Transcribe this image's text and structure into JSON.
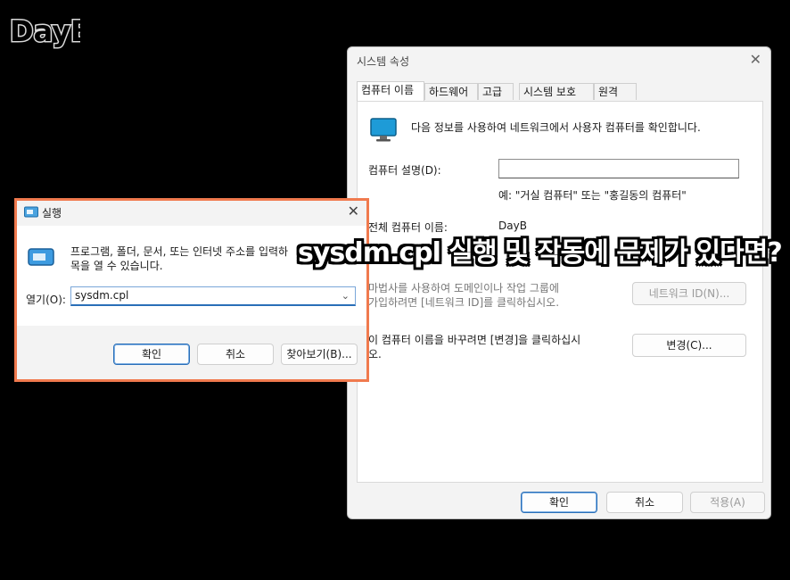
{
  "logo": {
    "text": "DayB"
  },
  "system_properties": {
    "title": "시스템 속성",
    "tabs": [
      {
        "label": "컴퓨터 이름",
        "active": true
      },
      {
        "label": "하드웨어"
      },
      {
        "label": "고급"
      },
      {
        "label": "시스템 보호"
      },
      {
        "label": "원격"
      }
    ],
    "info_text": "다음 정보를 사용하여 네트워크에서 사용자 컴퓨터를 확인합니다.",
    "description_label": "컴퓨터 설명(D):",
    "description_value": "",
    "description_hint": "예: \"거실 컴퓨터\" 또는 \"홍길동의 컴퓨터\"",
    "full_name_label": "전체 컴퓨터 이름:",
    "full_name_value": "DayB",
    "network_text_1": "마법사를 사용하여 도메인이나 작업 그룹에",
    "network_text_2": "가입하려면 [네트워크 ID]를 클릭하십시오.",
    "network_button": "네트워크 ID(N)...",
    "change_text_1": "이 컴퓨터 이름을 바꾸려면 [변경]을 클릭하십시",
    "change_text_2": "오.",
    "change_button": "변경(C)...",
    "ok_button": "확인",
    "cancel_button": "취소",
    "apply_button": "적용(A)",
    "close_glyph": "✕"
  },
  "run_dialog": {
    "title": "실행",
    "description": "프로그램, 폴더, 문서, 또는 인터넷 주소를 입력하",
    "description_2": "목을 열 수 있습니다.",
    "open_label": "열기(O):",
    "input_value": "sysdm.cpl",
    "ok_button": "확인",
    "cancel_button": "취소",
    "browse_button": "찾아보기(B)...",
    "close_glyph": "✕"
  },
  "overlay": {
    "headline": "sysdm.cpl 실행 및 작동에 문제가 있다면?"
  },
  "colors": {
    "highlight_border": "#f07a4e",
    "accent": "#2a6fb8",
    "background": "#000000"
  }
}
